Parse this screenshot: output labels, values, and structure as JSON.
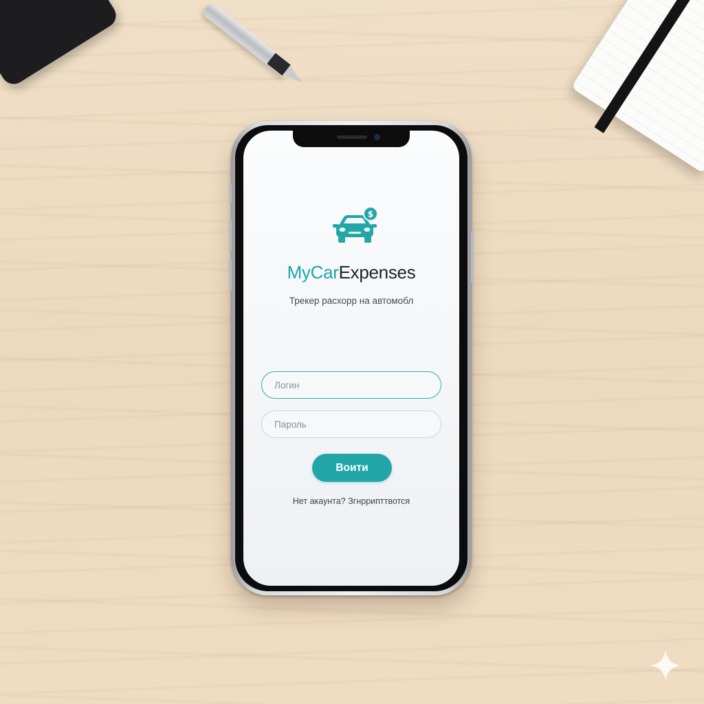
{
  "app": {
    "name_part1": "MyCar",
    "name_part2": "Expenses",
    "subtitle": "Трекер расхорр на автомобл"
  },
  "form": {
    "login_placeholder": "Логин",
    "password_placeholder": "Пароль",
    "submit_label": "Воити"
  },
  "footer": {
    "register_text": "Нет акаунта? Згнррипттвотся"
  },
  "icons": {
    "logo": "car-dollar-icon",
    "watermark": "sparkle-icon"
  },
  "colors": {
    "accent": "#23a6a8",
    "title_dark": "#1f2428",
    "field_border_active": "#2bb0b3",
    "field_border": "#cfd4d9",
    "desk": "#eedcc3"
  }
}
